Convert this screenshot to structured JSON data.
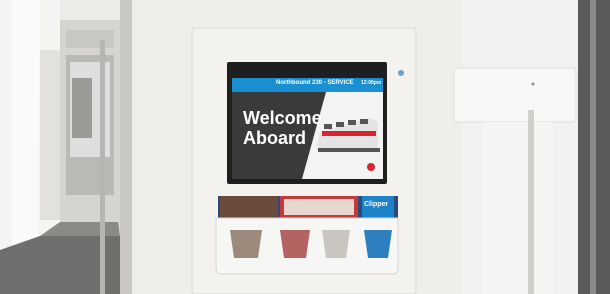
{
  "screen": {
    "banner_left": "Northbound 230 - SERVICE",
    "banner_right": "12:00pm",
    "headline": "Welcome Aboard",
    "banner_color": "#1a8fd1",
    "screen_bg": "#3a3a3a",
    "train_accent": "#d9232e"
  },
  "brochure": {
    "card_label": "Clipper"
  },
  "colors": {
    "wall": "#efefec",
    "panel": "#f2f1ee",
    "floor": "#6e6e6e",
    "corridor": "#d9d7d2"
  }
}
